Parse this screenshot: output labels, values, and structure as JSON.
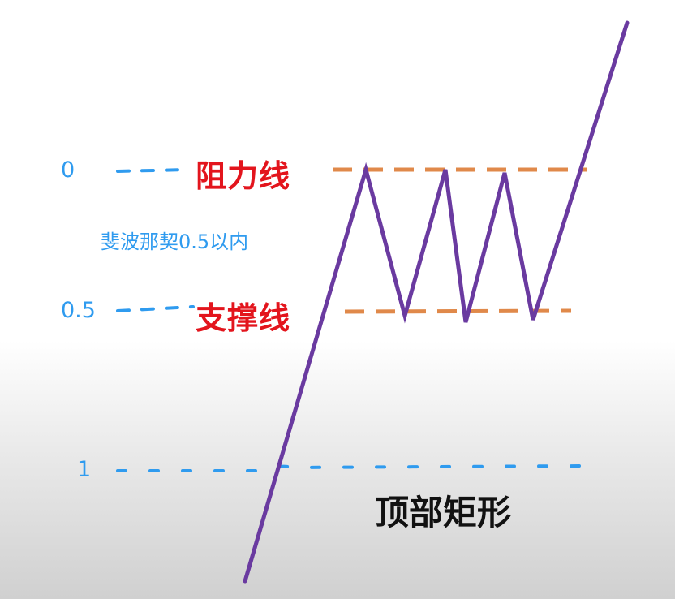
{
  "levels": {
    "zero": "0",
    "half": "0.5",
    "one": "1"
  },
  "labels": {
    "resistance": "阻力线",
    "support": "支撑线",
    "fib_note": "斐波那契0.5以内"
  },
  "title": "顶部矩形",
  "colors": {
    "level_text": "#2f9bef",
    "level_dash": "#2f9bef",
    "line_label": "#e3151d",
    "band_dash": "#e0894a",
    "price_path": "#6a3aa0"
  }
}
